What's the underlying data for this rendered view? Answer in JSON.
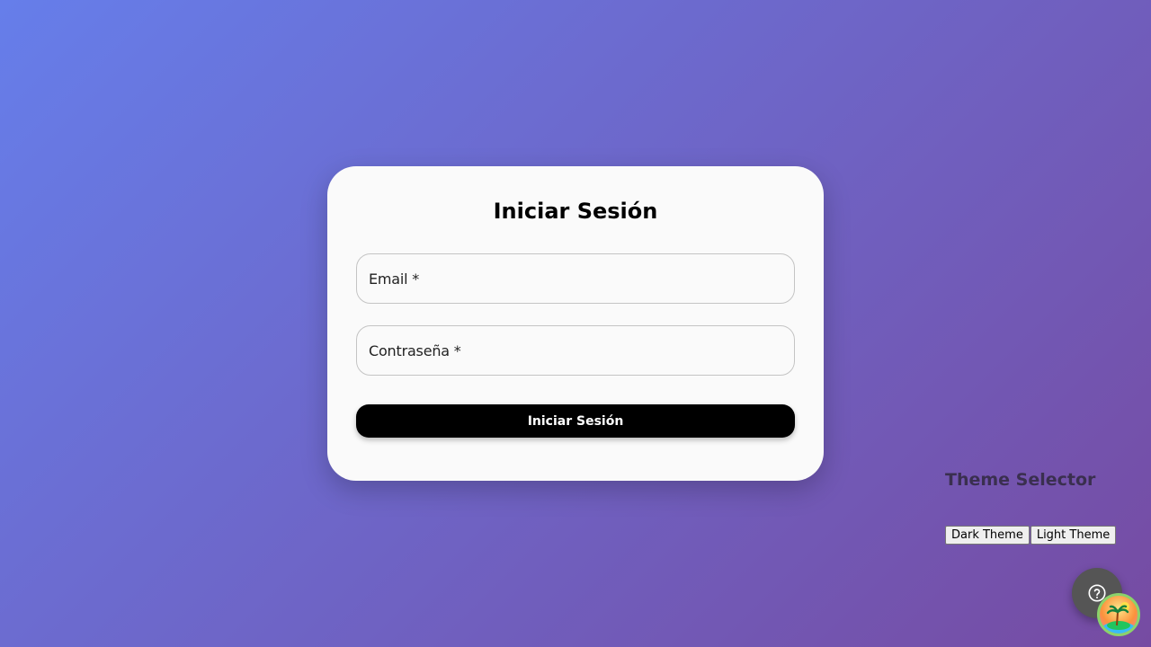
{
  "login": {
    "title": "Iniciar Sesión",
    "email_label": "Email *",
    "password_label": "Contraseña *",
    "submit_label": "Iniciar Sesión"
  },
  "theme_selector": {
    "title": "Theme Selector",
    "dark_label": "Dark Theme",
    "light_label": "Light Theme"
  },
  "fab": {
    "icon": "help-circle-icon"
  },
  "colors": {
    "background_start": "#667eea",
    "background_end": "#764ba2",
    "card": "#fafafa",
    "primary_button": "#000000"
  }
}
